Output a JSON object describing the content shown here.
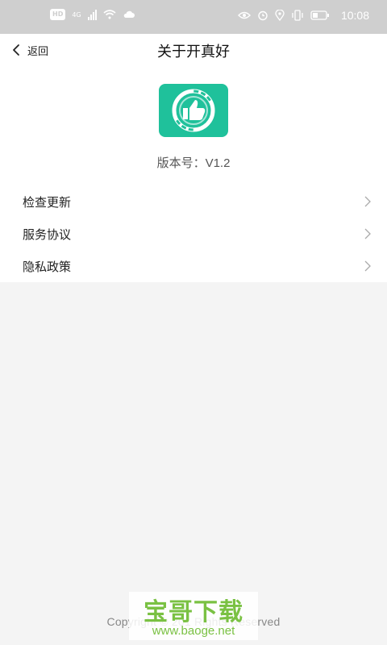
{
  "status_bar": {
    "left_badge": "HD",
    "network": "4G",
    "time": "10:08"
  },
  "header": {
    "back_label": "返回",
    "title": "关于开真好"
  },
  "app": {
    "version": "版本号：V1.2",
    "brand_color": "#1fc19b"
  },
  "menu": [
    {
      "label": "检查更新"
    },
    {
      "label": "服务协议"
    },
    {
      "label": "隐私政策"
    }
  ],
  "footer": {
    "copyright": "Copyright © 201      Rights Reserved"
  },
  "watermark": {
    "line1": "宝哥下载",
    "line2": "www.baoge.net"
  }
}
